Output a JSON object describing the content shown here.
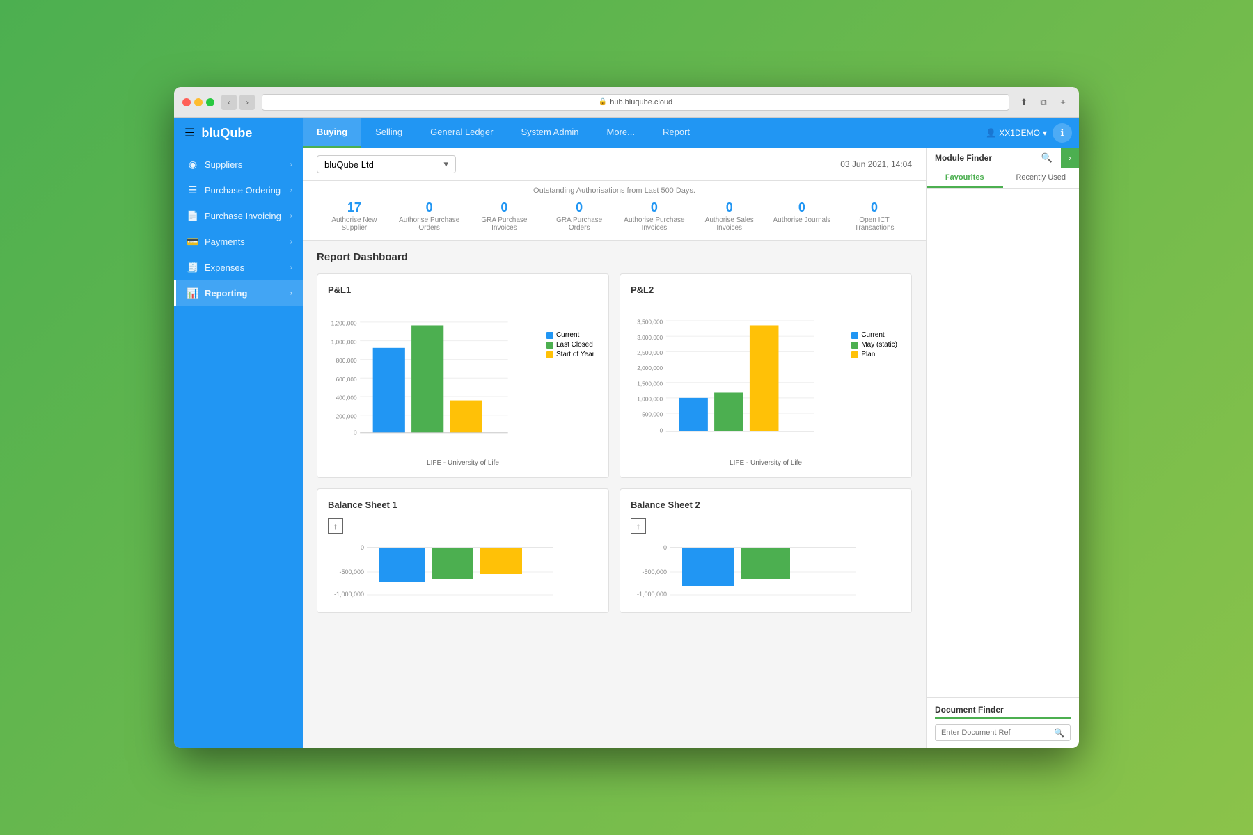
{
  "browser": {
    "url": "hub.bluqube.cloud"
  },
  "app": {
    "brand": "bluQube",
    "user": "XX1DEMO"
  },
  "nav": {
    "tabs": [
      {
        "label": "Buying",
        "active": true
      },
      {
        "label": "Selling",
        "active": false
      },
      {
        "label": "General Ledger",
        "active": false
      },
      {
        "label": "System Admin",
        "active": false
      },
      {
        "label": "More...",
        "active": false
      },
      {
        "label": "Report",
        "active": false
      }
    ]
  },
  "sidebar": {
    "items": [
      {
        "label": "Suppliers",
        "icon": "👥",
        "active": false
      },
      {
        "label": "Purchase Ordering",
        "icon": "📋",
        "active": false
      },
      {
        "label": "Purchase Invoicing",
        "icon": "📄",
        "active": false
      },
      {
        "label": "Payments",
        "icon": "💳",
        "active": false
      },
      {
        "label": "Expenses",
        "icon": "🧾",
        "active": false
      },
      {
        "label": "Reporting",
        "icon": "📊",
        "active": true
      }
    ]
  },
  "subheader": {
    "company": "bluQube Ltd",
    "date": "03 Jun 2021, 14:04"
  },
  "auth_banner": {
    "title": "Outstanding Authorisations from Last 500 Days.",
    "items": [
      {
        "count": "17",
        "label": "Authorise New Supplier"
      },
      {
        "count": "0",
        "label": "Authorise Purchase Orders"
      },
      {
        "count": "0",
        "label": "GRA Purchase Invoices"
      },
      {
        "count": "0",
        "label": "GRA Purchase Orders"
      },
      {
        "count": "0",
        "label": "Authorise Purchase Invoices"
      },
      {
        "count": "0",
        "label": "Authorise Sales Invoices"
      },
      {
        "count": "0",
        "label": "Authorise Journals"
      },
      {
        "count": "0",
        "label": "Open ICT Transactions"
      }
    ]
  },
  "dashboard": {
    "title": "Report Dashboard",
    "charts": [
      {
        "id": "pl1",
        "title": "P&L1",
        "x_label": "LIFE - University of Life",
        "legend": [
          {
            "label": "Current",
            "color": "#2196f3"
          },
          {
            "label": "Last Closed",
            "color": "#4caf50"
          },
          {
            "label": "Start of Year",
            "color": "#ffc107"
          }
        ],
        "y_labels": [
          "1,200,000",
          "1,000,000",
          "800,000",
          "600,000",
          "400,000",
          "200,000",
          "0"
        ],
        "bars": [
          {
            "value": 75,
            "color": "#2196f3"
          },
          {
            "value": 95,
            "color": "#4caf50"
          },
          {
            "value": 30,
            "color": "#ffc107"
          }
        ]
      },
      {
        "id": "pl2",
        "title": "P&L2",
        "x_label": "LIFE - University of Life",
        "legend": [
          {
            "label": "Current",
            "color": "#2196f3"
          },
          {
            "label": "May (static)",
            "color": "#4caf50"
          },
          {
            "label": "Plan",
            "color": "#ffc107"
          }
        ],
        "y_labels": [
          "3,500,000",
          "3,000,000",
          "2,500,000",
          "2,000,000",
          "1,500,000",
          "1,000,000",
          "500,000",
          "0"
        ],
        "bars": [
          {
            "value": 30,
            "color": "#2196f3"
          },
          {
            "value": 35,
            "color": "#4caf50"
          },
          {
            "value": 95,
            "color": "#ffc107"
          }
        ]
      },
      {
        "id": "balance1",
        "title": "Balance Sheet 1",
        "x_label": "",
        "y_labels": [
          "0",
          "-500,000",
          "-1,000,000"
        ],
        "bars": [
          {
            "value": 60,
            "color": "#2196f3"
          },
          {
            "value": 55,
            "color": "#4caf50"
          },
          {
            "value": 45,
            "color": "#ffc107"
          }
        ]
      },
      {
        "id": "balance2",
        "title": "Balance Sheet 2",
        "x_label": "",
        "y_labels": [
          "0",
          "-500,000",
          "-1,000,000"
        ],
        "bars": [
          {
            "value": 65,
            "color": "#2196f3"
          },
          {
            "value": 55,
            "color": "#4caf50"
          }
        ]
      }
    ]
  },
  "right_panel": {
    "module_finder_label": "Module Finder",
    "tabs": [
      {
        "label": "Favourites",
        "active": true
      },
      {
        "label": "Recently Used",
        "active": false
      }
    ],
    "doc_finder": {
      "label": "Document Finder",
      "placeholder": "Enter Document Ref"
    }
  }
}
